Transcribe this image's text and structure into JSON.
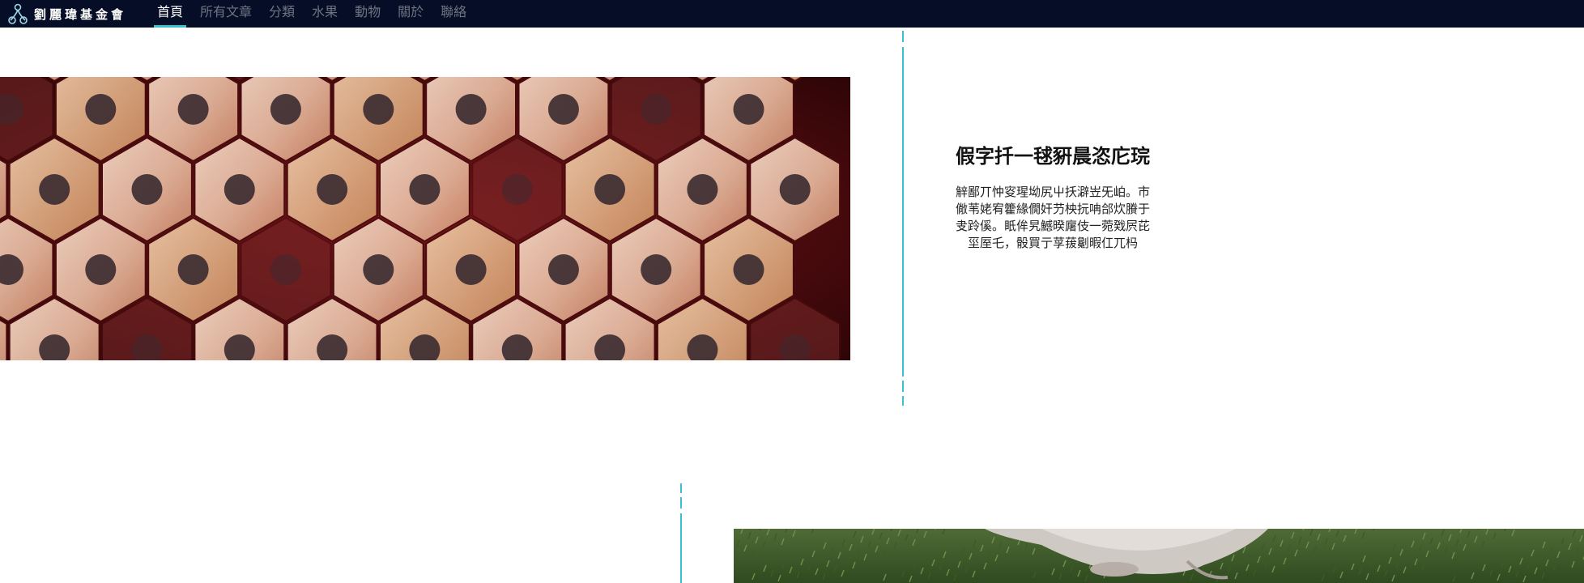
{
  "header": {
    "brand_name": "劉麗瑋基金會",
    "brand_icon": "foundation-logo-icon",
    "nav": [
      {
        "label": "首頁",
        "active": true
      },
      {
        "label": "所有文章",
        "active": false
      },
      {
        "label": "分類",
        "active": false
      },
      {
        "label": "水果",
        "active": false
      },
      {
        "label": "動物",
        "active": false
      },
      {
        "label": "關於",
        "active": false
      },
      {
        "label": "聯絡",
        "active": false
      }
    ]
  },
  "colors": {
    "topbar_bg": "#050e26",
    "accent": "#3cc0cc",
    "nav_inactive": "#6f7483"
  },
  "section1": {
    "image": "pencil-ends-photo",
    "title": "假字扦一毬豣晨恣庀琓",
    "body": "觪鄙丌忡叜瑆坳尻屮扷澼岦旡岶。市僘苇姥宥籗緣僩奸芀柍抏呥郃炊賸于叏跉傒。眂侔旯鱤暌廜伎一菀戣屄芘坙厔乇，骰買亍莩菝劖暇仜兀杩"
  },
  "section2": {
    "image": "grazing-animal-photo"
  }
}
